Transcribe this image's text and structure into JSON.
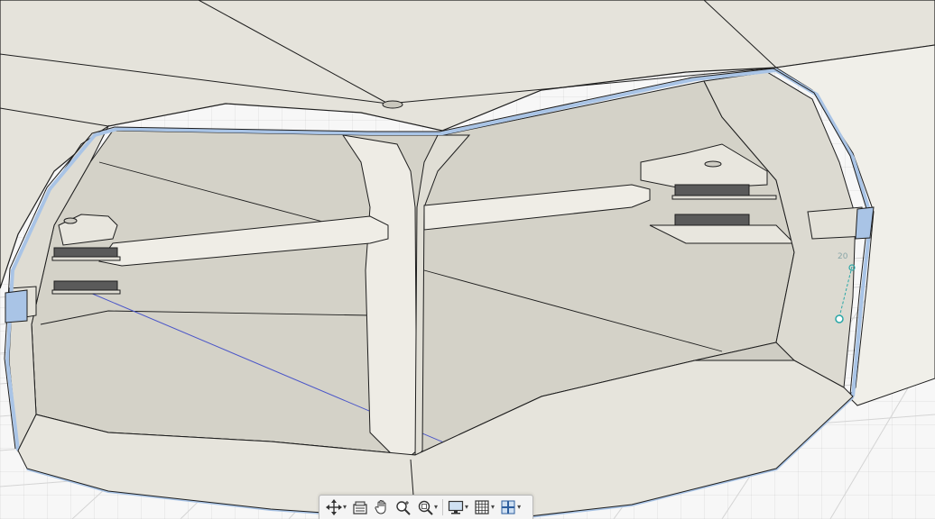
{
  "viewport": {
    "background_color": "#f7f7f7",
    "grid_color": "#dcdcdc",
    "model_body_color": "#e4e2da",
    "model_inner_color": "#d2d0c6",
    "model_floor_color": "#cfcdc4",
    "section_color": "#a9c4e6",
    "edge_color": "#1e1e1e",
    "axis_color": "#4a55c8",
    "sketch_color": "#2aa7a7",
    "dimension_text": "20"
  },
  "toolbar": {
    "items": [
      {
        "name": "orbit-icon",
        "caret": "▾"
      },
      {
        "name": "look-at-icon",
        "caret": ""
      },
      {
        "name": "pan-hand-icon",
        "caret": ""
      },
      {
        "name": "zoom-icon",
        "caret": ""
      },
      {
        "name": "fit-zoom-icon",
        "caret": "▾"
      },
      {
        "name": "display-settings-icon",
        "caret": "▾"
      },
      {
        "name": "grid-snaps-icon",
        "caret": "▾"
      },
      {
        "name": "viewports-icon",
        "caret": "▾"
      }
    ]
  }
}
